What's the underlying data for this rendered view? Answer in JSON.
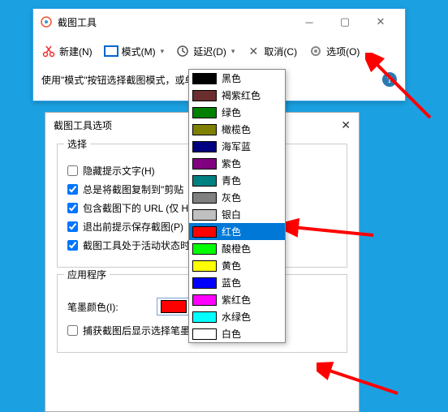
{
  "app": {
    "title": "截图工具"
  },
  "toolbar": {
    "new_label": "新建(N)",
    "mode_label": "模式(M)",
    "delay_label": "延迟(D)",
    "cancel_label": "取消(C)",
    "options_label": "选项(O)"
  },
  "hint": {
    "text": "使用\"模式\"按钮选择截图模式，或单"
  },
  "dialog": {
    "title": "截图工具选项",
    "group_select": "选择",
    "cb_hide_hint": "隐藏提示文字(H)",
    "cb_copy_clip": "总是将截图复制到\"剪贴",
    "cb_include_url": "包含截图下的 URL (仅 H",
    "cb_prompt_save": "退出前提示保存截图(P)",
    "cb_active_state": "截图工具处于活动状态时",
    "group_app": "应用程序",
    "ink_color_label": "笔墨颜色(I):",
    "cb_show_ink": "捕获截图后显示选择笔墨(O)"
  },
  "combo": {
    "selected_color": "#ff0000",
    "selected_label": "红色"
  },
  "colors": [
    {
      "hex": "#000000",
      "label": "黑色"
    },
    {
      "hex": "#6b2e2e",
      "label": "褐紫红色"
    },
    {
      "hex": "#008000",
      "label": "绿色"
    },
    {
      "hex": "#808000",
      "label": "橄榄色"
    },
    {
      "hex": "#000080",
      "label": "海军蓝"
    },
    {
      "hex": "#800080",
      "label": "紫色"
    },
    {
      "hex": "#008080",
      "label": "青色"
    },
    {
      "hex": "#808080",
      "label": "灰色"
    },
    {
      "hex": "#c0c0c0",
      "label": "银白"
    },
    {
      "hex": "#ff0000",
      "label": "红色",
      "selected": true
    },
    {
      "hex": "#00ff00",
      "label": "酸橙色"
    },
    {
      "hex": "#ffff00",
      "label": "黄色"
    },
    {
      "hex": "#0000ff",
      "label": "蓝色"
    },
    {
      "hex": "#ff00ff",
      "label": "紫红色"
    },
    {
      "hex": "#00ffff",
      "label": "水绿色"
    },
    {
      "hex": "#ffffff",
      "label": "白色"
    }
  ]
}
